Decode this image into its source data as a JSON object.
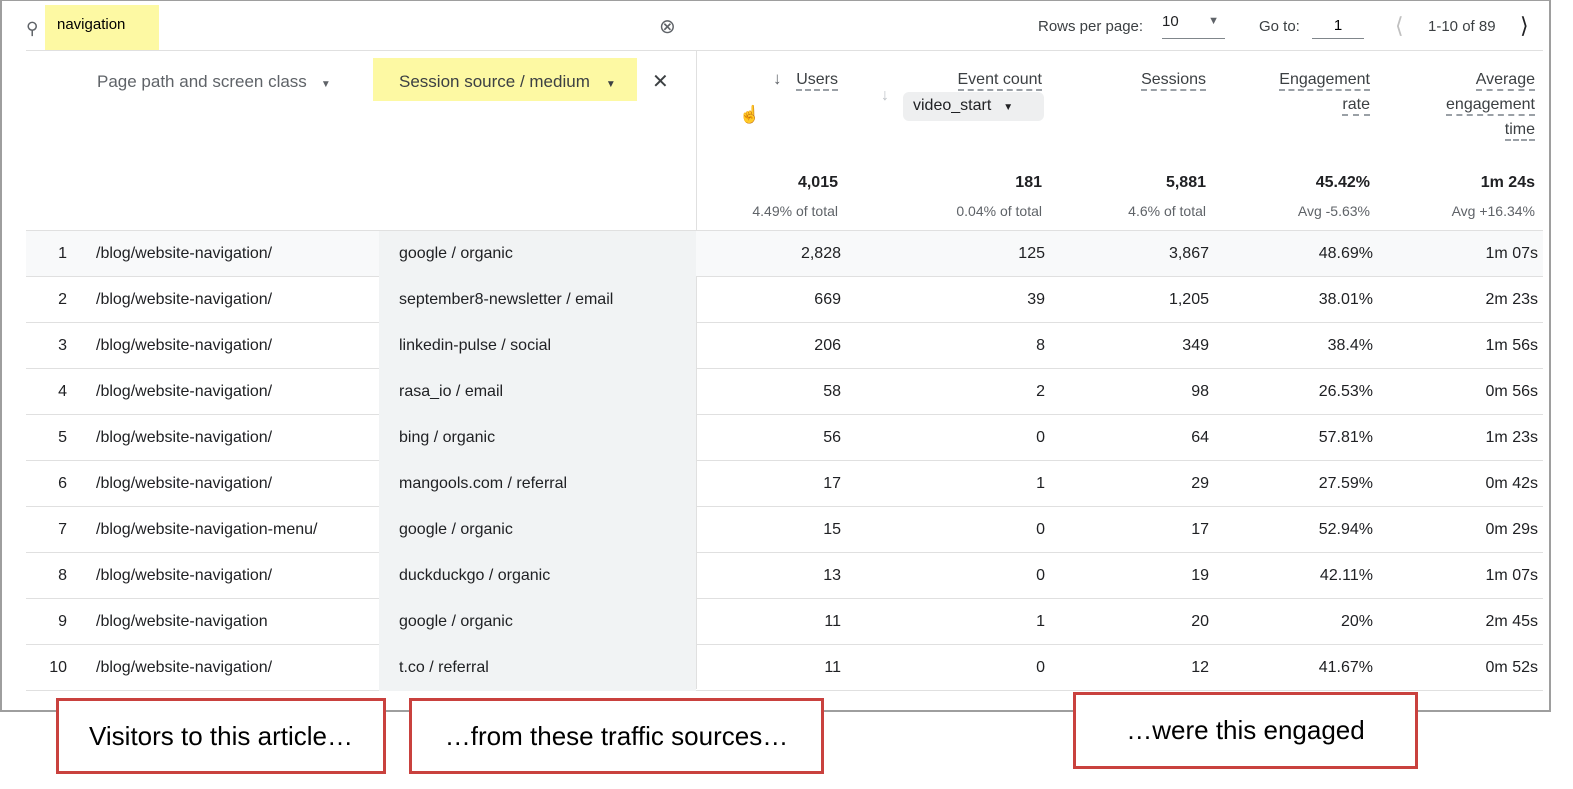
{
  "search": {
    "value": "navigation",
    "icon": "search-icon"
  },
  "pagination": {
    "rows_label": "Rows per page:",
    "rows_value": "10",
    "goto_label": "Go to:",
    "goto_value": "1",
    "range": "1-10 of 89"
  },
  "dimensions": {
    "primary": "Page path and screen class",
    "secondary": "Session source / medium"
  },
  "metrics": {
    "users": "Users",
    "event_count": "Event count",
    "event_filter": "video_start",
    "sessions": "Sessions",
    "engagement_rate_1": "Engagement",
    "engagement_rate_2": "rate",
    "avg_1": "Average",
    "avg_2": "engagement",
    "avg_3": "time"
  },
  "totals": {
    "users": "4,015",
    "users_sub": "4.49% of total",
    "events": "181",
    "events_sub": "0.04% of total",
    "sessions": "5,881",
    "sessions_sub": "4.6% of total",
    "eng": "45.42%",
    "eng_sub": "Avg -5.63%",
    "avg": "1m 24s",
    "avg_sub": "Avg +16.34%"
  },
  "rows": [
    {
      "n": "1",
      "path": "/blog/website-navigation/",
      "source": "google / organic",
      "users": "2,828",
      "events": "125",
      "sessions": "3,867",
      "eng": "48.69%",
      "avg": "1m 07s"
    },
    {
      "n": "2",
      "path": "/blog/website-navigation/",
      "source": "september8-newsletter / email",
      "users": "669",
      "events": "39",
      "sessions": "1,205",
      "eng": "38.01%",
      "avg": "2m 23s"
    },
    {
      "n": "3",
      "path": "/blog/website-navigation/",
      "source": "linkedin-pulse / social",
      "users": "206",
      "events": "8",
      "sessions": "349",
      "eng": "38.4%",
      "avg": "1m 56s"
    },
    {
      "n": "4",
      "path": "/blog/website-navigation/",
      "source": "rasa_io / email",
      "users": "58",
      "events": "2",
      "sessions": "98",
      "eng": "26.53%",
      "avg": "0m 56s"
    },
    {
      "n": "5",
      "path": "/blog/website-navigation/",
      "source": "bing / organic",
      "users": "56",
      "events": "0",
      "sessions": "64",
      "eng": "57.81%",
      "avg": "1m 23s"
    },
    {
      "n": "6",
      "path": "/blog/website-navigation/",
      "source": "mangools.com / referral",
      "users": "17",
      "events": "1",
      "sessions": "29",
      "eng": "27.59%",
      "avg": "0m 42s"
    },
    {
      "n": "7",
      "path": "/blog/website-navigation-menu/",
      "source": "google / organic",
      "users": "15",
      "events": "0",
      "sessions": "17",
      "eng": "52.94%",
      "avg": "0m 29s"
    },
    {
      "n": "8",
      "path": "/blog/website-navigation/",
      "source": "duckduckgo / organic",
      "users": "13",
      "events": "0",
      "sessions": "19",
      "eng": "42.11%",
      "avg": "1m 07s"
    },
    {
      "n": "9",
      "path": "/blog/website-navigation",
      "source": "google / organic",
      "users": "11",
      "events": "1",
      "sessions": "20",
      "eng": "20%",
      "avg": "2m 45s"
    },
    {
      "n": "10",
      "path": "/blog/website-navigation/",
      "source": "t.co / referral",
      "users": "11",
      "events": "0",
      "sessions": "12",
      "eng": "41.67%",
      "avg": "0m 52s"
    }
  ],
  "annotations": [
    "Visitors to this article…",
    "…from these traffic sources…",
    "…were this engaged"
  ],
  "colors": {
    "highlight": "#fdf9a3",
    "annotation_border": "#c9413e"
  }
}
